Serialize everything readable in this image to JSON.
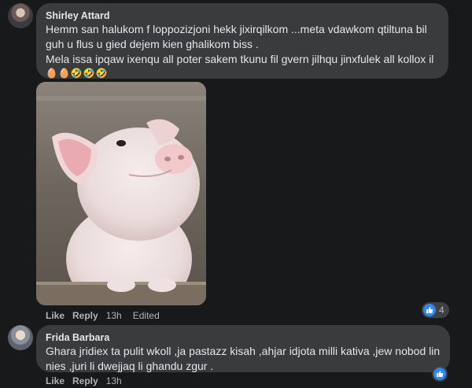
{
  "comments": [
    {
      "author": "Shirley Attard",
      "lines": [
        "Hemm san halukom f loppozizjoni hekk jixirqilkom ...meta vdawkom qtiltuna bil",
        "guh u flus u gied dejem kien ghalikom biss .",
        "Mela issa ipqaw ixenqu all poter sakem tkunu fil gvern jilhqu jinxfulek all kollox il"
      ],
      "emojis": "🥚🥚🤣🤣🤣",
      "like_label": "Like",
      "reply_label": "Reply",
      "time": "13h",
      "edited_label": "Edited",
      "reaction_count": "4"
    },
    {
      "author": "Frida Barbara",
      "lines": [
        "Ghara jridiex ta pulit wkoll ,ja pastazz kisah ,ahjar idjota milli kativa ,jew nobod lin",
        "nies ,juri li dwejjaq li ghandu zgur ."
      ],
      "like_label": "Like",
      "reply_label": "Reply",
      "time": "13h"
    }
  ],
  "icons": {
    "reaction": "thumbs-up-icon",
    "reaction_color": "#2d88ff"
  }
}
